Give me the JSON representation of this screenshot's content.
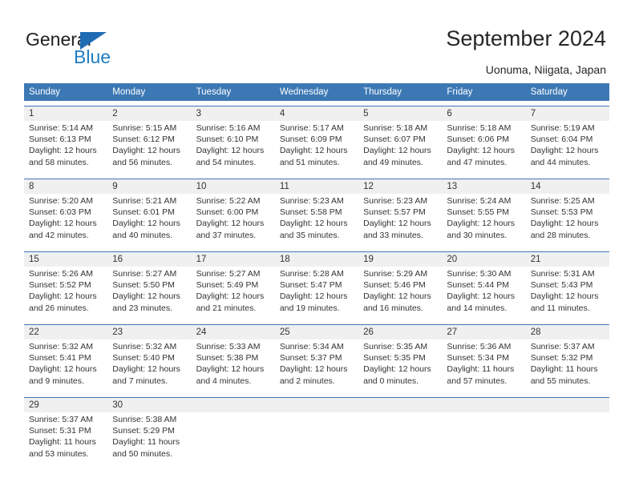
{
  "brand": {
    "name_top": "General",
    "name_bottom": "Blue",
    "triangle_color": "#1f6cb4",
    "blue_color": "#1f7dc0"
  },
  "header": {
    "title": "September 2024",
    "subtitle": "Uonuma, Niigata, Japan"
  },
  "theme": {
    "header_blue": "#3c78b4",
    "daynum_band": "#f0f0f0",
    "text": "#333333"
  },
  "weekdays": [
    "Sunday",
    "Monday",
    "Tuesday",
    "Wednesday",
    "Thursday",
    "Friday",
    "Saturday"
  ],
  "weeks": [
    {
      "days": [
        {
          "num": "1",
          "sunrise": "Sunrise: 5:14 AM",
          "sunset": "Sunset: 6:13 PM",
          "daylight1": "Daylight: 12 hours",
          "daylight2": "and 58 minutes."
        },
        {
          "num": "2",
          "sunrise": "Sunrise: 5:15 AM",
          "sunset": "Sunset: 6:12 PM",
          "daylight1": "Daylight: 12 hours",
          "daylight2": "and 56 minutes."
        },
        {
          "num": "3",
          "sunrise": "Sunrise: 5:16 AM",
          "sunset": "Sunset: 6:10 PM",
          "daylight1": "Daylight: 12 hours",
          "daylight2": "and 54 minutes."
        },
        {
          "num": "4",
          "sunrise": "Sunrise: 5:17 AM",
          "sunset": "Sunset: 6:09 PM",
          "daylight1": "Daylight: 12 hours",
          "daylight2": "and 51 minutes."
        },
        {
          "num": "5",
          "sunrise": "Sunrise: 5:18 AM",
          "sunset": "Sunset: 6:07 PM",
          "daylight1": "Daylight: 12 hours",
          "daylight2": "and 49 minutes."
        },
        {
          "num": "6",
          "sunrise": "Sunrise: 5:18 AM",
          "sunset": "Sunset: 6:06 PM",
          "daylight1": "Daylight: 12 hours",
          "daylight2": "and 47 minutes."
        },
        {
          "num": "7",
          "sunrise": "Sunrise: 5:19 AM",
          "sunset": "Sunset: 6:04 PM",
          "daylight1": "Daylight: 12 hours",
          "daylight2": "and 44 minutes."
        }
      ]
    },
    {
      "days": [
        {
          "num": "8",
          "sunrise": "Sunrise: 5:20 AM",
          "sunset": "Sunset: 6:03 PM",
          "daylight1": "Daylight: 12 hours",
          "daylight2": "and 42 minutes."
        },
        {
          "num": "9",
          "sunrise": "Sunrise: 5:21 AM",
          "sunset": "Sunset: 6:01 PM",
          "daylight1": "Daylight: 12 hours",
          "daylight2": "and 40 minutes."
        },
        {
          "num": "10",
          "sunrise": "Sunrise: 5:22 AM",
          "sunset": "Sunset: 6:00 PM",
          "daylight1": "Daylight: 12 hours",
          "daylight2": "and 37 minutes."
        },
        {
          "num": "11",
          "sunrise": "Sunrise: 5:23 AM",
          "sunset": "Sunset: 5:58 PM",
          "daylight1": "Daylight: 12 hours",
          "daylight2": "and 35 minutes."
        },
        {
          "num": "12",
          "sunrise": "Sunrise: 5:23 AM",
          "sunset": "Sunset: 5:57 PM",
          "daylight1": "Daylight: 12 hours",
          "daylight2": "and 33 minutes."
        },
        {
          "num": "13",
          "sunrise": "Sunrise: 5:24 AM",
          "sunset": "Sunset: 5:55 PM",
          "daylight1": "Daylight: 12 hours",
          "daylight2": "and 30 minutes."
        },
        {
          "num": "14",
          "sunrise": "Sunrise: 5:25 AM",
          "sunset": "Sunset: 5:53 PM",
          "daylight1": "Daylight: 12 hours",
          "daylight2": "and 28 minutes."
        }
      ]
    },
    {
      "days": [
        {
          "num": "15",
          "sunrise": "Sunrise: 5:26 AM",
          "sunset": "Sunset: 5:52 PM",
          "daylight1": "Daylight: 12 hours",
          "daylight2": "and 26 minutes."
        },
        {
          "num": "16",
          "sunrise": "Sunrise: 5:27 AM",
          "sunset": "Sunset: 5:50 PM",
          "daylight1": "Daylight: 12 hours",
          "daylight2": "and 23 minutes."
        },
        {
          "num": "17",
          "sunrise": "Sunrise: 5:27 AM",
          "sunset": "Sunset: 5:49 PM",
          "daylight1": "Daylight: 12 hours",
          "daylight2": "and 21 minutes."
        },
        {
          "num": "18",
          "sunrise": "Sunrise: 5:28 AM",
          "sunset": "Sunset: 5:47 PM",
          "daylight1": "Daylight: 12 hours",
          "daylight2": "and 19 minutes."
        },
        {
          "num": "19",
          "sunrise": "Sunrise: 5:29 AM",
          "sunset": "Sunset: 5:46 PM",
          "daylight1": "Daylight: 12 hours",
          "daylight2": "and 16 minutes."
        },
        {
          "num": "20",
          "sunrise": "Sunrise: 5:30 AM",
          "sunset": "Sunset: 5:44 PM",
          "daylight1": "Daylight: 12 hours",
          "daylight2": "and 14 minutes."
        },
        {
          "num": "21",
          "sunrise": "Sunrise: 5:31 AM",
          "sunset": "Sunset: 5:43 PM",
          "daylight1": "Daylight: 12 hours",
          "daylight2": "and 11 minutes."
        }
      ]
    },
    {
      "days": [
        {
          "num": "22",
          "sunrise": "Sunrise: 5:32 AM",
          "sunset": "Sunset: 5:41 PM",
          "daylight1": "Daylight: 12 hours",
          "daylight2": "and 9 minutes."
        },
        {
          "num": "23",
          "sunrise": "Sunrise: 5:32 AM",
          "sunset": "Sunset: 5:40 PM",
          "daylight1": "Daylight: 12 hours",
          "daylight2": "and 7 minutes."
        },
        {
          "num": "24",
          "sunrise": "Sunrise: 5:33 AM",
          "sunset": "Sunset: 5:38 PM",
          "daylight1": "Daylight: 12 hours",
          "daylight2": "and 4 minutes."
        },
        {
          "num": "25",
          "sunrise": "Sunrise: 5:34 AM",
          "sunset": "Sunset: 5:37 PM",
          "daylight1": "Daylight: 12 hours",
          "daylight2": "and 2 minutes."
        },
        {
          "num": "26",
          "sunrise": "Sunrise: 5:35 AM",
          "sunset": "Sunset: 5:35 PM",
          "daylight1": "Daylight: 12 hours",
          "daylight2": "and 0 minutes."
        },
        {
          "num": "27",
          "sunrise": "Sunrise: 5:36 AM",
          "sunset": "Sunset: 5:34 PM",
          "daylight1": "Daylight: 11 hours",
          "daylight2": "and 57 minutes."
        },
        {
          "num": "28",
          "sunrise": "Sunrise: 5:37 AM",
          "sunset": "Sunset: 5:32 PM",
          "daylight1": "Daylight: 11 hours",
          "daylight2": "and 55 minutes."
        }
      ]
    },
    {
      "days": [
        {
          "num": "29",
          "sunrise": "Sunrise: 5:37 AM",
          "sunset": "Sunset: 5:31 PM",
          "daylight1": "Daylight: 11 hours",
          "daylight2": "and 53 minutes."
        },
        {
          "num": "30",
          "sunrise": "Sunrise: 5:38 AM",
          "sunset": "Sunset: 5:29 PM",
          "daylight1": "Daylight: 11 hours",
          "daylight2": "and 50 minutes."
        },
        {
          "num": "",
          "sunrise": "",
          "sunset": "",
          "daylight1": "",
          "daylight2": ""
        },
        {
          "num": "",
          "sunrise": "",
          "sunset": "",
          "daylight1": "",
          "daylight2": ""
        },
        {
          "num": "",
          "sunrise": "",
          "sunset": "",
          "daylight1": "",
          "daylight2": ""
        },
        {
          "num": "",
          "sunrise": "",
          "sunset": "",
          "daylight1": "",
          "daylight2": ""
        },
        {
          "num": "",
          "sunrise": "",
          "sunset": "",
          "daylight1": "",
          "daylight2": ""
        }
      ]
    }
  ]
}
